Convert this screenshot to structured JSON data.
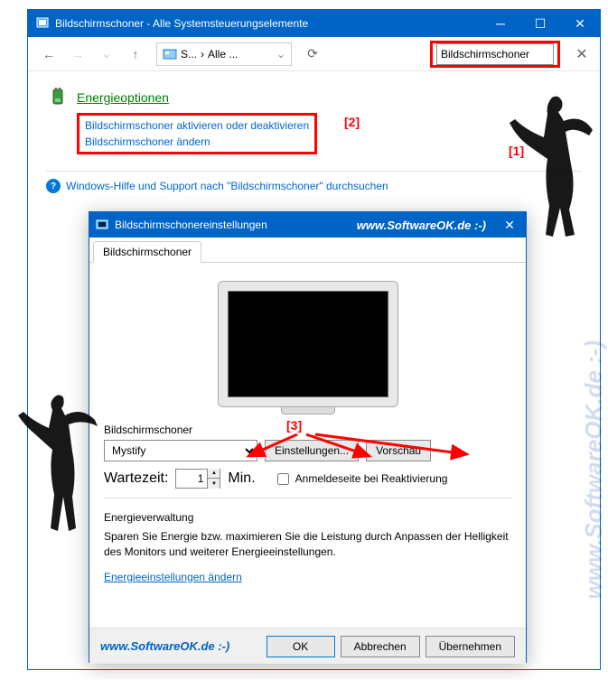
{
  "mainWindow": {
    "title": "Bildschirmschoner - Alle Systemsteuerungselemente",
    "breadcrumb": {
      "part1": "S...",
      "sep": "›",
      "part2": "Alle ..."
    },
    "search": {
      "value": "Bildschirmschoner"
    }
  },
  "content": {
    "energyTitle": "Energieoptionen",
    "link1": "Bildschirmschoner aktivieren oder deaktivieren",
    "link2": "Bildschirmschoner ändern",
    "helpText": "Windows-Hilfe und Support nach \"Bildschirmschoner\" durchsuchen"
  },
  "markers": {
    "m1": "[1]",
    "m2": "[2]",
    "m3": "[3]"
  },
  "dialog": {
    "title": "Bildschirmschonereinstellungen",
    "watermark": "www.SoftwareOK.de :-)",
    "tab": "Bildschirmschoner",
    "groupLabel": "Bildschirmschoner",
    "dropdownValue": "Mystify",
    "settingsBtn": "Einstellungen...",
    "previewBtn": "Vorschau",
    "waitLabel": "Wartezeit:",
    "waitValue": "1",
    "waitUnit": "Min.",
    "resumeCheck": "Anmeldeseite bei Reaktivierung",
    "energyHeader": "Energieverwaltung",
    "energyDesc": "Sparen Sie Energie bzw. maximieren Sie die Leistung durch Anpassen der Helligkeit des Monitors und weiterer Energieeinstellungen.",
    "energyLink": "Energieeinstellungen ändern",
    "okBtn": "OK",
    "cancelBtn": "Abbrechen",
    "applyBtn": "Übernehmen"
  },
  "sideWatermark": "www.SoftwareOK.de :-)"
}
